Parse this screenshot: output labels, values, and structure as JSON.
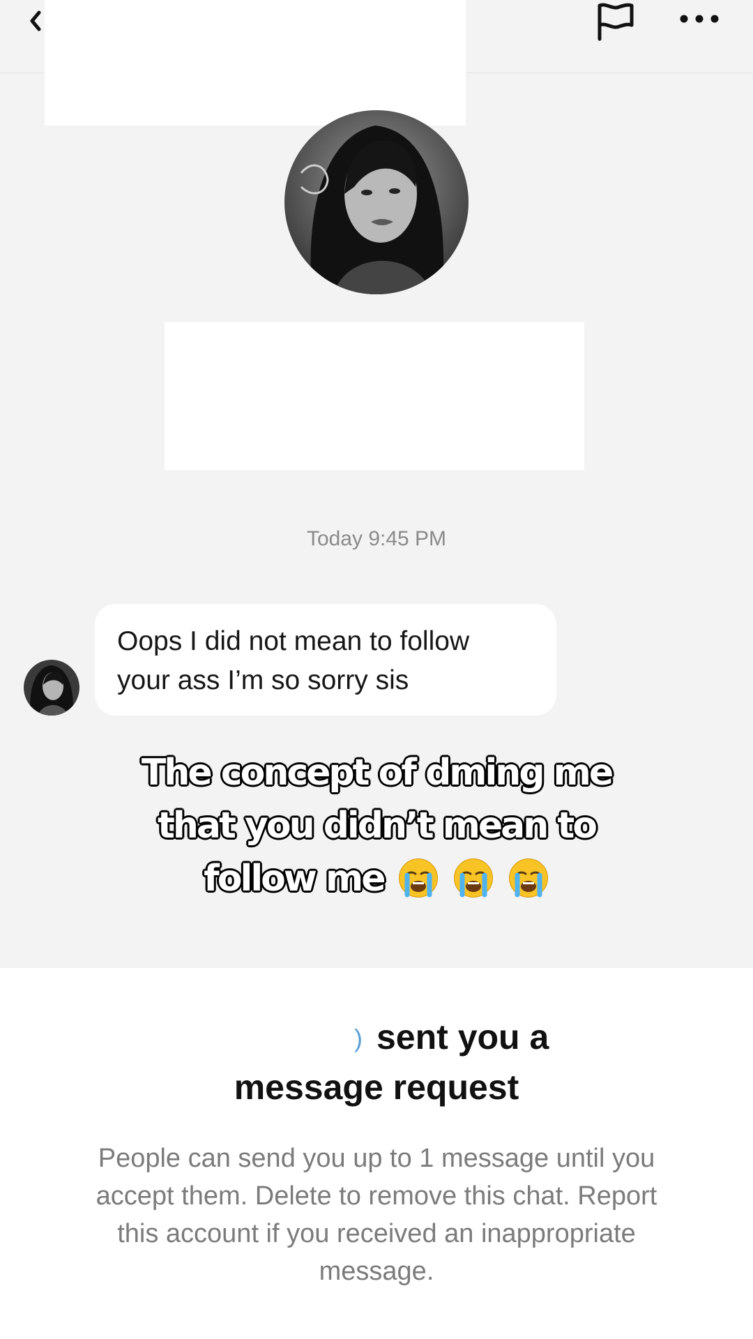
{
  "header": {
    "back_icon": "chevron-left-icon",
    "report_icon": "flag-icon",
    "more_icon": "more-horizontal-icon"
  },
  "conversation": {
    "timestamp": "Today 9:45 PM",
    "message": {
      "line1": "Oops I did not mean to follow",
      "line2": "your ass I’m so sorry sis"
    }
  },
  "overlay_caption": {
    "line1": "The concept of dming me",
    "line2": "that you didn’t mean to",
    "line3": "follow me",
    "emoji": "loudly-crying-face"
  },
  "message_request": {
    "cut_name_fragment": ")",
    "title_line1": "sent you a",
    "title_line2": "message request",
    "body_line1": "People can send you up to 1 message until you",
    "body_line2": "accept them. Delete to remove this chat. Report",
    "body_line3": "this account if you received an inappropriate",
    "body_line4": "message."
  },
  "colors": {
    "background": "#f3f3f3",
    "bubble": "#ffffff",
    "timestamp": "#8a8a8a",
    "body_text": "#7b7b7b"
  }
}
